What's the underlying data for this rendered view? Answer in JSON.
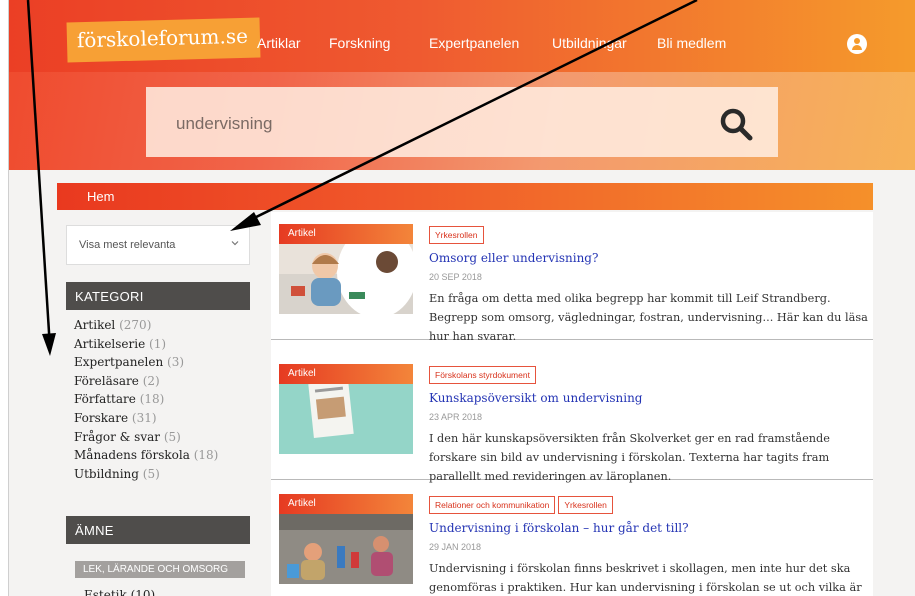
{
  "header": {
    "logo": "förskoleforum.se",
    "nav": [
      "Artiklar",
      "Forskning",
      "Expertpanelen",
      "Utbildningar",
      "Bli medlem"
    ]
  },
  "search": {
    "value": "undervisning"
  },
  "breadcrumb": "Hem",
  "sort": {
    "selected": "Visa mest relevanta"
  },
  "sidebar": {
    "category_heading": "KATEGORI",
    "categories": [
      {
        "label": "Artikel",
        "count": "(270)"
      },
      {
        "label": "Artikelserie",
        "count": "(1)"
      },
      {
        "label": "Expertpanelen",
        "count": "(3)"
      },
      {
        "label": "Föreläsare",
        "count": "(2)"
      },
      {
        "label": "Författare",
        "count": "(18)"
      },
      {
        "label": "Forskare",
        "count": "(31)"
      },
      {
        "label": "Frågor & svar",
        "count": "(5)"
      },
      {
        "label": "Månadens förskola",
        "count": "(18)"
      },
      {
        "label": "Utbildning",
        "count": "(5)"
      }
    ],
    "subject_heading": "ÄMNE",
    "subject_group": "LEK, LÄRANDE OCH OMSORG",
    "subject_first_item": "Estetik (10)"
  },
  "articles": [
    {
      "type": "Artikel",
      "tags": [
        "Yrkesrollen"
      ],
      "title": "Omsorg eller undervisning?",
      "date": "20 SEP 2018",
      "excerpt": "En fråga om detta med olika begrepp har kommit till Leif Strandberg. Begrepp som omsorg, vägledningar, fostran, undervisning... Här kan du läsa hur han svarar."
    },
    {
      "type": "Artikel",
      "tags": [
        "Förskolans styrdokument"
      ],
      "title": "Kunskapsöversikt om undervisning",
      "date": "23 APR 2018",
      "excerpt": "I den här kunskapsöversikten från Skolverket ger en rad framstående forskare sin bild av undervisning i förskolan. Texterna har tagits fram parallellt med revideringen av läroplanen."
    },
    {
      "type": "Artikel",
      "tags": [
        "Relationer och kommunikation",
        "Yrkesrollen"
      ],
      "title": "Undervisning i förskolan – hur går det till?",
      "date": "29 JAN 2018",
      "excerpt": "Undervisning i förskolan finns beskrivet i skollagen, men inte hur det ska genomföras i praktiken. Hur kan undervisning i förskolan se ut och vilka är förskolornas olika uppfattningar om..."
    }
  ],
  "colors": {
    "accent": "#ef4a2d",
    "link": "#2434b4",
    "tag": "#d8321c"
  }
}
